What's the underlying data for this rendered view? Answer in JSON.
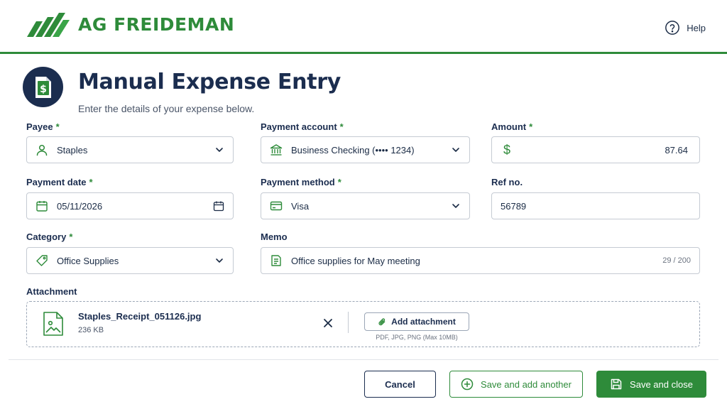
{
  "header": {
    "brand": "AG FREIDEMAN",
    "help_label": "Help"
  },
  "page": {
    "title": "Manual Expense Entry",
    "subtitle": "Enter the details of your expense below."
  },
  "form": {
    "required_mark": "*",
    "payee": {
      "label": "Payee",
      "value": "Staples"
    },
    "payment_account": {
      "label": "Payment account",
      "value": "Business Checking (•••• 1234)"
    },
    "amount": {
      "label": "Amount",
      "currency": "$",
      "value": "87.64"
    },
    "payment_date": {
      "label": "Payment date",
      "value": "05/11/2026"
    },
    "payment_method": {
      "label": "Payment method",
      "value": "Visa"
    },
    "ref_no": {
      "label": "Ref no.",
      "value": "56789"
    },
    "category": {
      "label": "Category",
      "value": "Office Supplies"
    },
    "memo": {
      "label": "Memo",
      "value": "Office supplies for May meeting",
      "counter": "29 / 200"
    }
  },
  "attachment": {
    "label": "Attachment",
    "file_name": "Staples_Receipt_051126.jpg",
    "file_size": "236 KB",
    "add_label": "Add attachment",
    "hint": "PDF, JPG, PNG (Max 10MB)"
  },
  "actions": {
    "cancel": "Cancel",
    "save_another": "Save and add another",
    "save_close": "Save and close"
  },
  "icons": {
    "payee": "user-icon",
    "payment_account": "bank-icon",
    "amount": "dollar-icon",
    "payment_date": "calendar-icon",
    "payment_method": "credit-card-icon",
    "category": "tag-icon",
    "memo": "note-icon",
    "attachment": "image-file-icon"
  },
  "colors": {
    "brand_green": "#2e8b3a",
    "navy": "#1b2d4f",
    "border": "#c5cbd3"
  }
}
